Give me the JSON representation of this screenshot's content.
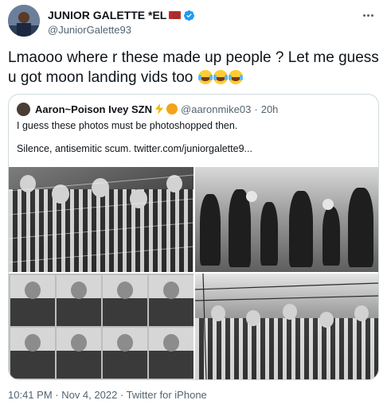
{
  "author": {
    "name": "JUNIOR GALETTE *EL",
    "handle": "@JuniorGalette93",
    "verified": true,
    "flag_icon": "morocco-flag-icon"
  },
  "tweet": {
    "text": "Lmaooo where r these made up people ? Let me guess u got moon landing vids too",
    "emojis": [
      "face-with-tears-of-joy",
      "face-with-tears-of-joy",
      "face-with-tears-of-joy"
    ]
  },
  "quote": {
    "name": "Aaron~Poison Ivey SZN",
    "name_emojis": [
      "high-voltage",
      "smiling-face-with-horns"
    ],
    "handle": "@aaronmike03",
    "separator": "·",
    "time": "20h",
    "line1": "I guess these photos must be photoshopped then.",
    "line2": "Silence, antisemitic scum.  twitter.com/juniorgalette9..."
  },
  "footer": {
    "timestamp": "10:41 PM · Nov 4, 2022 · Twitter for iPhone"
  },
  "colors": {
    "text_primary": "#0f1419",
    "text_secondary": "#536471",
    "verified_blue": "#1d9bf0",
    "border": "#cfd9de"
  }
}
